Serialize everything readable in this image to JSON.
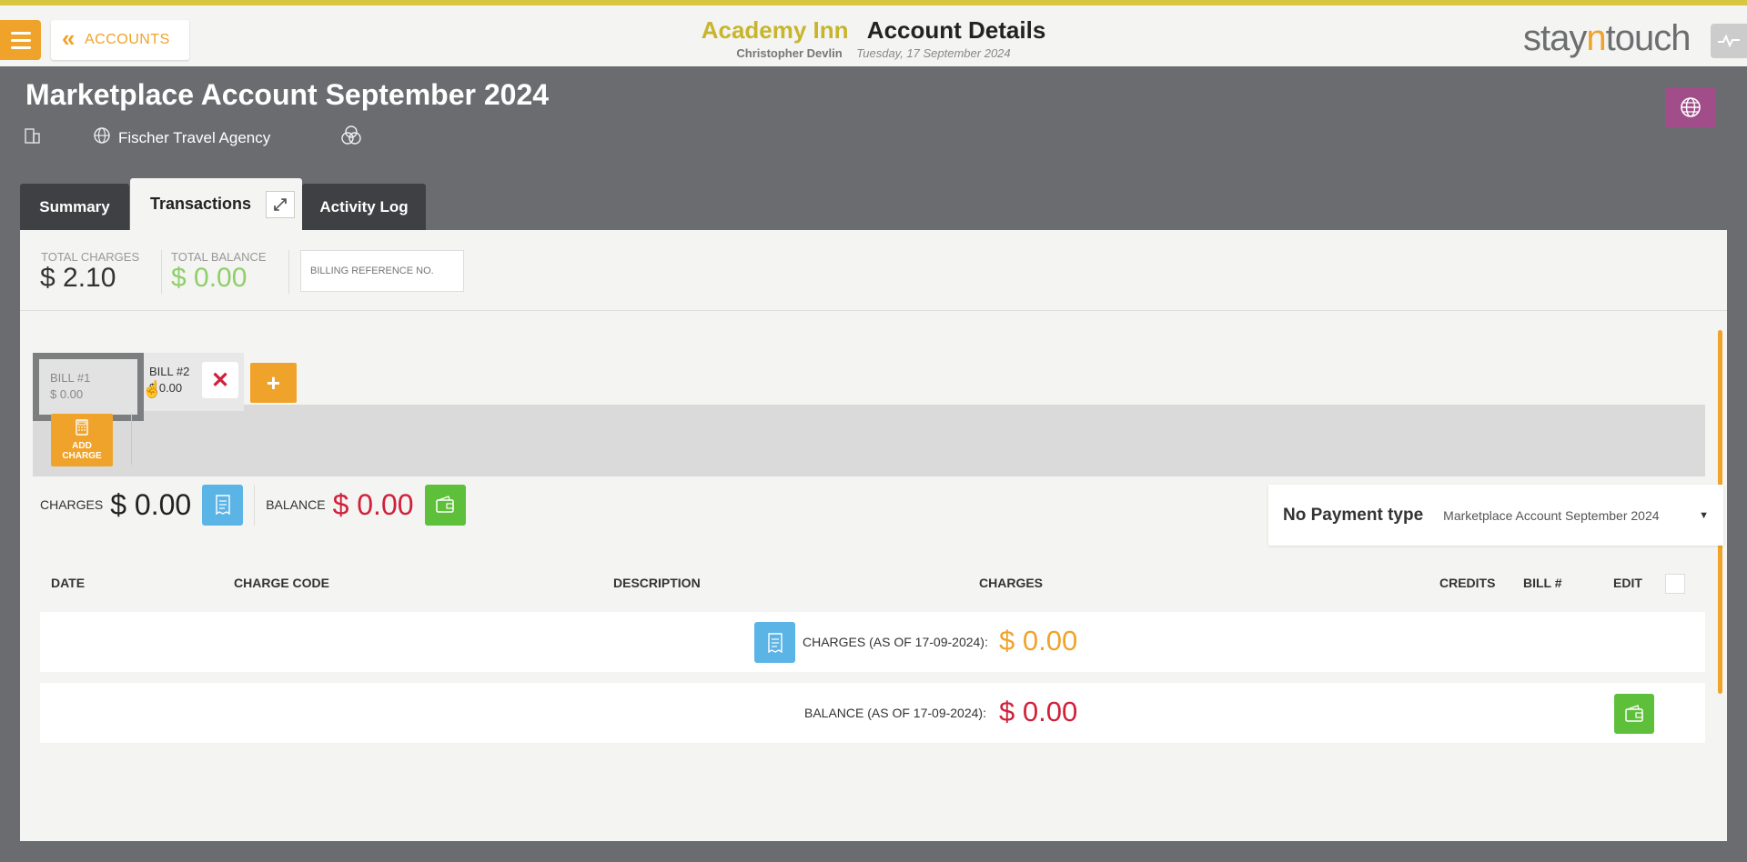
{
  "header": {
    "back_label": "ACCOUNTS",
    "hotel": "Academy Inn",
    "title": "Account Details",
    "user": "Christopher Devlin",
    "date": "Tuesday, 17 September 2024",
    "logo_left": "stay",
    "logo_mid": "n",
    "logo_right": "touch"
  },
  "account": {
    "title": "Marketplace Account September 2024",
    "agency": "Fischer Travel Agency"
  },
  "tabs": {
    "summary": "Summary",
    "transactions": "Transactions",
    "activity": "Activity Log"
  },
  "stats": {
    "total_charges_label": "TOTAL CHARGES",
    "total_charges": "$ 2.10",
    "total_balance_label": "TOTAL BALANCE",
    "total_balance": "$ 0.00",
    "billing_ref_placeholder": "BILLING REFERENCE NO."
  },
  "bills": [
    {
      "label": "BILL #1",
      "amount": "$ 0.00"
    },
    {
      "label": "BILL #2",
      "amount": "$ 0.00"
    }
  ],
  "add_charge": {
    "line1": "ADD",
    "line2": "CHARGE"
  },
  "summary": {
    "charges_label": "CHARGES",
    "charges_value": "$ 0.00",
    "balance_label": "BALANCE",
    "balance_value": "$ 0.00"
  },
  "payment": {
    "type_label": "No Payment type",
    "selected": "Marketplace Account September 2024"
  },
  "table": {
    "columns": [
      "DATE",
      "CHARGE CODE",
      "DESCRIPTION",
      "CHARGES",
      "CREDITS",
      "BILL #",
      "EDIT"
    ],
    "charges_row_label": "CHARGES (AS OF 17-09-2024):",
    "charges_row_value": "$ 0.00",
    "balance_row_label": "BALANCE (AS OF 17-09-2024):",
    "balance_row_value": "$ 0.00"
  },
  "colors": {
    "accent": "#f0a32a",
    "hotel": "#c7b52d",
    "red": "#d0213a",
    "green": "#5ec03a",
    "blue": "#5bb4e6",
    "purple": "#a04d8a"
  }
}
